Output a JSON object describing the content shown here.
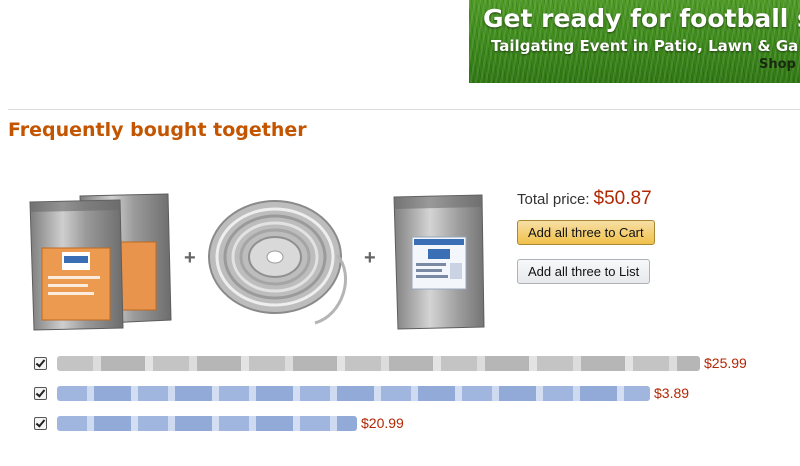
{
  "banner": {
    "headline": "Get ready for football se",
    "subline": "Tailgating Event in Patio, Lawn & Ga",
    "shop_text": "Shop"
  },
  "section": {
    "title": "Frequently bought together"
  },
  "products": [
    {
      "image_icon": "silver-pouch-pair-icon",
      "plus": "+"
    },
    {
      "image_icon": "wire-coil-icon",
      "plus": "+"
    },
    {
      "image_icon": "silver-pouch-icon"
    }
  ],
  "summary": {
    "total_label": "Total price:",
    "total_price": "$50.87",
    "add_cart_label": "Add all three to Cart",
    "add_list_label": "Add all three to List"
  },
  "items": [
    {
      "checked": true,
      "title": "",
      "price": "$25.99"
    },
    {
      "checked": true,
      "title": "",
      "price": "$3.89"
    },
    {
      "checked": true,
      "title": "",
      "price": "$20.99"
    }
  ],
  "colors": {
    "title_orange": "#c45500",
    "price_red": "#b12704",
    "cart_button": "#f0c14b",
    "banner_green": "#3f8c1c"
  }
}
